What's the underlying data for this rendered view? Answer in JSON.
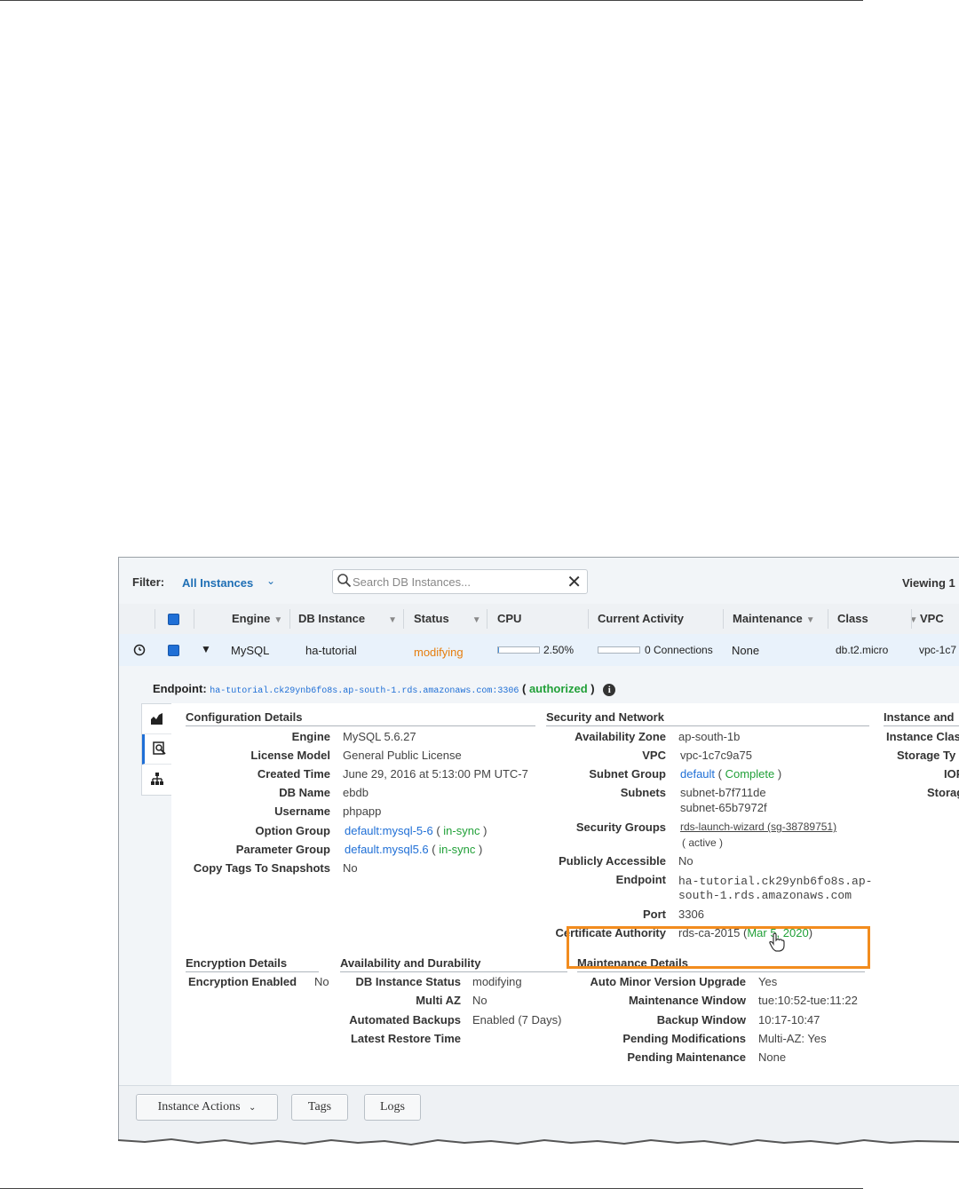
{
  "filter": {
    "label": "Filter:",
    "value": "All Instances",
    "search_placeholder": "Search DB Instances...",
    "viewing_text": "Viewing 1"
  },
  "columns": [
    "Engine",
    "DB Instance",
    "Status",
    "CPU",
    "Current Activity",
    "Maintenance",
    "Class",
    "VPC"
  ],
  "row": {
    "engine": "MySQL",
    "db_instance": "ha-tutorial",
    "status": "modifying",
    "cpu": "2.50%",
    "cpu_fraction": 0.025,
    "activity": "0 Connections",
    "maintenance": "None",
    "class": "db.t2.micro",
    "vpc": "vpc-1c7"
  },
  "endpoint": {
    "label": "Endpoint:",
    "value": "ha-tutorial.ck29ynb6fo8s.ap-south-1.rds.amazonaws.com:3306",
    "paren_open": "(",
    "status": "authorized",
    "paren_close": ")"
  },
  "configuration": {
    "title": "Configuration Details",
    "engine_label": "Engine",
    "engine": "MySQL 5.6.27",
    "license_label": "License Model",
    "license": "General Public License",
    "created_label": "Created Time",
    "created": "June 29, 2016 at 5:13:00 PM UTC-7",
    "dbname_label": "DB Name",
    "dbname": "ebdb",
    "username_label": "Username",
    "username": "phpapp",
    "option_label": "Option Group",
    "option_group": "default:mysql-5-6",
    "option_status": "in-sync",
    "param_label": "Parameter Group",
    "param_group": "default.mysql5.6",
    "param_status": "in-sync",
    "copytags_label": "Copy Tags To Snapshots",
    "copytags": "No"
  },
  "security": {
    "title": "Security and Network",
    "az_label": "Availability Zone",
    "az": "ap-south-1b",
    "vpc_label": "VPC",
    "vpc": "vpc-1c7c9a75",
    "subnet_group_label": "Subnet Group",
    "subnet_group": "default",
    "subnet_group_status": "Complete",
    "subnets_label": "Subnets",
    "subnet_1": "subnet-b7f711de",
    "subnet_2": "subnet-65b7972f",
    "sg_label": "Security Groups",
    "sg": "rds-launch-wizard (sg-38789751)",
    "sg_status": "active",
    "public_label": "Publicly Accessible",
    "public": "No",
    "endpoint_label": "Endpoint",
    "endpoint_1": "ha-tutorial.ck29ynb6fo8s.ap-",
    "endpoint_2": "south-1.rds.amazonaws.com",
    "port_label": "Port",
    "port": "3306",
    "ca_label": "Certificate Authority",
    "ca": "rds-ca-2015",
    "ca_date": "Mar 5, 2020"
  },
  "instance_section": {
    "title": "Instance and",
    "class_label": "Instance Clas",
    "storage_type_label": "Storage Ty",
    "iops_label": "IOP",
    "storage_label": "Storag"
  },
  "encryption": {
    "title": "Encryption Details",
    "enabled_label": "Encryption Enabled",
    "enabled": "No"
  },
  "availability": {
    "title": "Availability and Durability",
    "status_label": "DB Instance Status",
    "status": "modifying",
    "multiaz_label": "Multi AZ",
    "multiaz": "No",
    "backups_label": "Automated Backups",
    "backups": "Enabled (7 Days)",
    "restore_label": "Latest Restore Time"
  },
  "maintenance": {
    "title": "Maintenance Details",
    "auto_label": "Auto Minor Version Upgrade",
    "auto": "Yes",
    "window_label": "Maintenance Window",
    "window": "tue:10:52-tue:11:22",
    "backup_window_label": "Backup Window",
    "backup_window": "10:17-10:47",
    "pending_mod_label": "Pending Modifications",
    "pending_mod": "Multi-AZ: Yes",
    "pending_maint_label": "Pending Maintenance",
    "pending_maint": "None"
  },
  "actions": {
    "instance_actions": "Instance Actions",
    "tags": "Tags",
    "logs": "Logs"
  },
  "colors": {
    "link": "#1f6fd6",
    "status_orange": "#e67e0f",
    "ok_green": "#21a038",
    "error_red": "#d0291f",
    "highlight": "#f28c1e"
  }
}
